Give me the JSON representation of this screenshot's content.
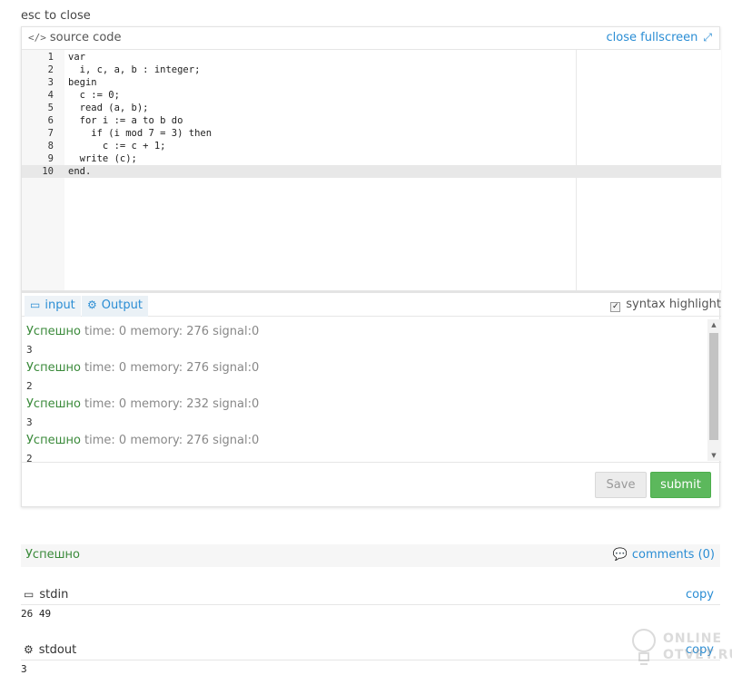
{
  "esc_hint": "esc to close",
  "source": {
    "title": "source code",
    "close_fullscreen": "close fullscreen",
    "active_line": 10,
    "lines": [
      {
        "n": "1",
        "text": "var"
      },
      {
        "n": "2",
        "text": "  i, c, a, b : integer;"
      },
      {
        "n": "3",
        "text": "begin"
      },
      {
        "n": "4",
        "text": "  c := 0;"
      },
      {
        "n": "5",
        "text": "  read (a, b);"
      },
      {
        "n": "6",
        "text": "  for i := a to b do"
      },
      {
        "n": "7",
        "text": "    if (i mod 7 = 3) then"
      },
      {
        "n": "8",
        "text": "      c := c + 1;"
      },
      {
        "n": "9",
        "text": "  write (c);"
      },
      {
        "n": "10",
        "text": "end."
      }
    ]
  },
  "io": {
    "input_tab": "input",
    "output_tab": "Output",
    "syntax_highlight": "syntax highlight",
    "syntax_checked": true
  },
  "output": [
    {
      "status": "Успешно",
      "meta": " time: 0 memory: 276 signal:0",
      "value": "3"
    },
    {
      "status": "Успешно",
      "meta": " time: 0 memory: 276 signal:0",
      "value": "2"
    },
    {
      "status": "Успешно",
      "meta": " time: 0 memory: 232 signal:0",
      "value": "3"
    },
    {
      "status": "Успешно",
      "meta": " time: 0 memory: 276 signal:0",
      "value": "2"
    }
  ],
  "buttons": {
    "save": "Save",
    "submit": "submit"
  },
  "result": {
    "status": "Успешно",
    "comments": "comments (0)"
  },
  "stdin": {
    "label": "stdin",
    "copy": "copy",
    "value": "26 49"
  },
  "stdout": {
    "label": "stdout",
    "copy": "copy",
    "value": "3"
  },
  "watermark": {
    "line1": "ONLINE",
    "line2": "OTVET.RU"
  },
  "colors": {
    "accent": "#2a8dd4",
    "success": "#3a8a3a",
    "submit_bg": "#5cb85c"
  }
}
